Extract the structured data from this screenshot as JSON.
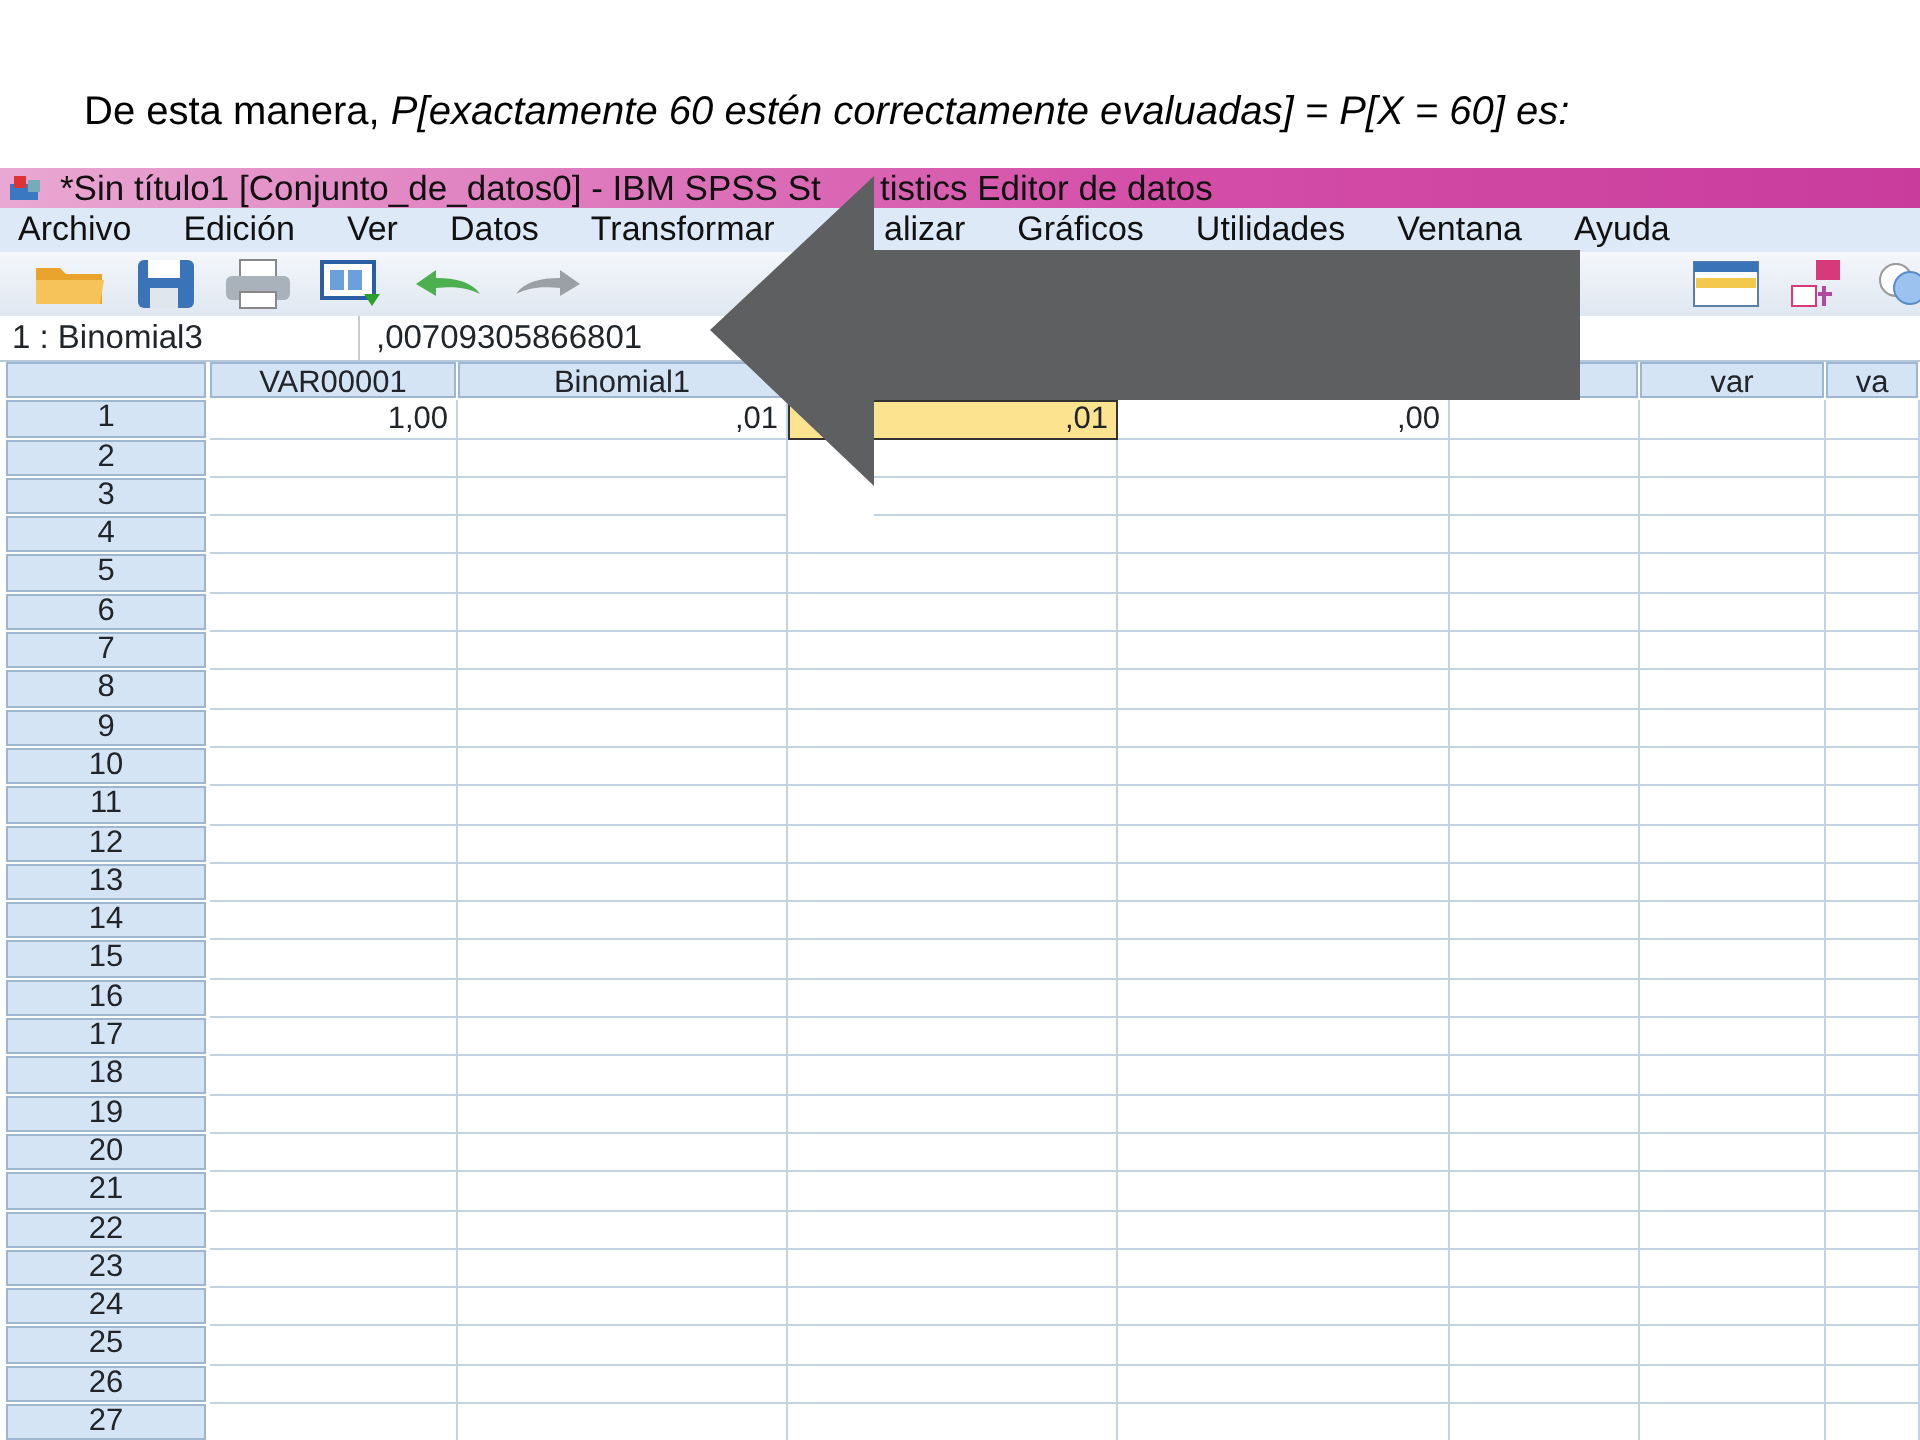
{
  "slide_heading": "De esta manera, *P[exactamente 60 estén correctamente evaluadas] = P[X = 60] es:*",
  "window": {
    "title_parts": [
      "*Sin título1 [Conjunto_de_datos0] - IBM SPSS St",
      "tistics Editor de datos"
    ]
  },
  "menu": [
    {
      "label": "Archivo"
    },
    {
      "label": "Edición"
    },
    {
      "label": "Ver"
    },
    {
      "label": "Datos"
    },
    {
      "label": "Transformar"
    },
    {
      "label": "alizar"
    },
    {
      "label": "Gráficos"
    },
    {
      "label": "Utilidades"
    },
    {
      "label": "Ventana"
    },
    {
      "label": "Ayuda"
    }
  ],
  "cell_editor": {
    "cell": "1 : Binomial3",
    "value": ",00709305866801"
  },
  "grid": {
    "columns": [
      {
        "kind": "named",
        "header": "VAR00001"
      },
      {
        "kind": "named",
        "header": "Binomial1"
      },
      {
        "kind": "covered"
      },
      {
        "kind": "covered"
      },
      {
        "kind": "covered"
      },
      {
        "kind": "named",
        "header": "var"
      },
      {
        "kind": "named",
        "header": "va"
      }
    ],
    "rows": [
      {
        "number": "1",
        "cells": [
          {
            "value": "1,00",
            "selected": false
          },
          {
            "value": ",01",
            "selected": false
          },
          {
            "value": ",01",
            "selected": true
          },
          {
            "value": ",00",
            "selected": false
          }
        ]
      },
      {
        "number": "2"
      },
      {
        "number": "3"
      },
      {
        "number": "4"
      },
      {
        "number": "5"
      },
      {
        "number": "6"
      },
      {
        "number": "7"
      },
      {
        "number": "8"
      },
      {
        "number": "9"
      },
      {
        "number": "10"
      },
      {
        "number": "11"
      },
      {
        "number": "12"
      },
      {
        "number": "13"
      },
      {
        "number": "14"
      },
      {
        "number": "15"
      },
      {
        "number": "16"
      },
      {
        "number": "17"
      },
      {
        "number": "18"
      },
      {
        "number": "19"
      },
      {
        "number": "20"
      },
      {
        "number": "21"
      },
      {
        "number": "22"
      },
      {
        "number": "23"
      },
      {
        "number": "24"
      },
      {
        "number": "25"
      },
      {
        "number": "26"
      },
      {
        "number": "27"
      }
    ]
  }
}
